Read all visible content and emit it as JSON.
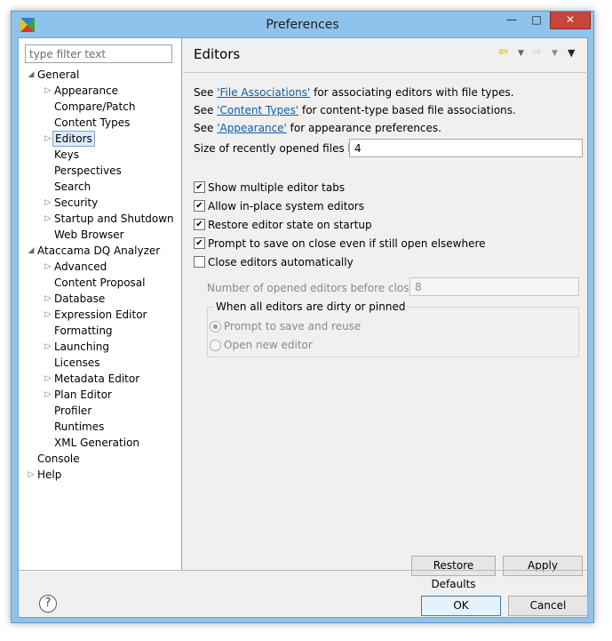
{
  "window": {
    "title": "Preferences",
    "minimize_glyph": "—",
    "maximize_glyph": "□",
    "close_glyph": "✕"
  },
  "filter": {
    "placeholder": "type filter text",
    "value": ""
  },
  "tree": [
    {
      "label": "General",
      "level": 0,
      "expander": "expanded"
    },
    {
      "label": "Appearance",
      "level": 1,
      "expander": "collapsed"
    },
    {
      "label": "Compare/Patch",
      "level": 1,
      "expander": "none"
    },
    {
      "label": "Content Types",
      "level": 1,
      "expander": "none"
    },
    {
      "label": "Editors",
      "level": 1,
      "expander": "collapsed",
      "selected": true
    },
    {
      "label": "Keys",
      "level": 1,
      "expander": "none"
    },
    {
      "label": "Perspectives",
      "level": 1,
      "expander": "none"
    },
    {
      "label": "Search",
      "level": 1,
      "expander": "none"
    },
    {
      "label": "Security",
      "level": 1,
      "expander": "collapsed"
    },
    {
      "label": "Startup and Shutdown",
      "level": 1,
      "expander": "collapsed"
    },
    {
      "label": "Web Browser",
      "level": 1,
      "expander": "none"
    },
    {
      "label": "Ataccama DQ Analyzer",
      "level": 0,
      "expander": "expanded"
    },
    {
      "label": "Advanced",
      "level": 1,
      "expander": "collapsed"
    },
    {
      "label": "Content Proposal",
      "level": 1,
      "expander": "none"
    },
    {
      "label": "Database",
      "level": 1,
      "expander": "collapsed"
    },
    {
      "label": "Expression Editor",
      "level": 1,
      "expander": "collapsed"
    },
    {
      "label": "Formatting",
      "level": 1,
      "expander": "none"
    },
    {
      "label": "Launching",
      "level": 1,
      "expander": "collapsed"
    },
    {
      "label": "Licenses",
      "level": 1,
      "expander": "none"
    },
    {
      "label": "Metadata Editor",
      "level": 1,
      "expander": "collapsed"
    },
    {
      "label": "Plan Editor",
      "level": 1,
      "expander": "collapsed"
    },
    {
      "label": "Profiler",
      "level": 1,
      "expander": "none"
    },
    {
      "label": "Runtimes",
      "level": 1,
      "expander": "none"
    },
    {
      "label": "XML Generation",
      "level": 1,
      "expander": "none"
    },
    {
      "label": "Console",
      "level": 0,
      "expander": "none"
    },
    {
      "label": "Help",
      "level": 0,
      "expander": "collapsed"
    }
  ],
  "page": {
    "title": "Editors",
    "nav_icons": {
      "back": "back-arrow-icon",
      "forward": "forward-arrow-icon",
      "menu": "view-menu-icon"
    },
    "links": [
      {
        "prefix": "See ",
        "link": "'File Associations'",
        "suffix": " for associating editors with file types."
      },
      {
        "prefix": "See ",
        "link": "'Content Types'",
        "suffix": " for content-type based file associations."
      },
      {
        "prefix": "See ",
        "link": "'Appearance'",
        "suffix": " for appearance preferences."
      }
    ],
    "recent_files_label": "Size of recently opened files list:",
    "recent_files_value": "4",
    "checkboxes": [
      {
        "label": "Show multiple editor tabs",
        "checked": true
      },
      {
        "label": "Allow in-place system editors",
        "checked": true
      },
      {
        "label": "Restore editor state on startup",
        "checked": true
      },
      {
        "label": "Prompt to save on close even if still open elsewhere",
        "checked": true
      },
      {
        "label": "Close editors automatically",
        "checked": false
      }
    ],
    "opened_editors_label": "Number of opened editors before closing:",
    "opened_editors_value": "8",
    "dirty_group": {
      "title": "When all editors are dirty or pinned",
      "options": [
        {
          "label": "Prompt to save and reuse",
          "selected": true
        },
        {
          "label": "Open new editor",
          "selected": false
        }
      ]
    },
    "restore_defaults_label": "Restore Defaults",
    "apply_label": "Apply"
  },
  "footer": {
    "help_glyph": "?",
    "ok_label": "OK",
    "cancel_label": "Cancel"
  }
}
